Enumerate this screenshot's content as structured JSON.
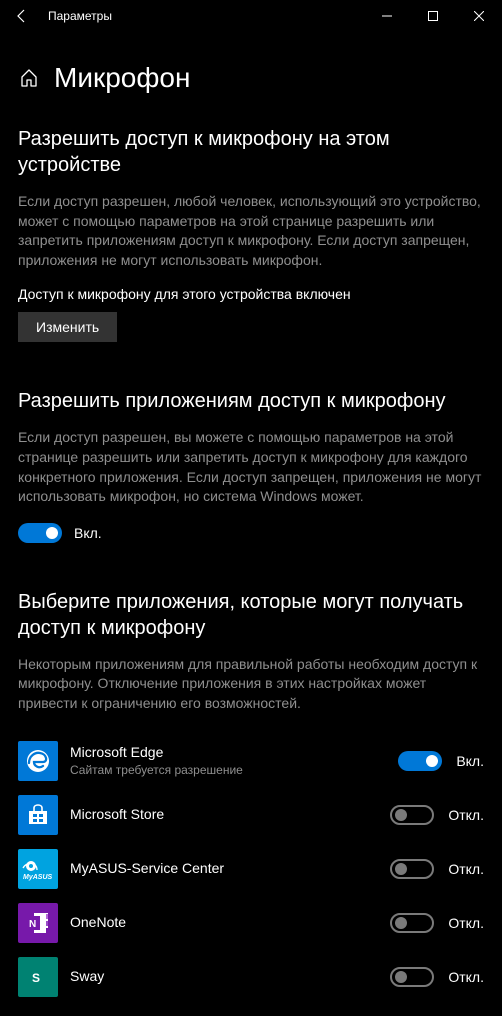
{
  "window": {
    "title": "Параметры"
  },
  "page": {
    "title": "Микрофон"
  },
  "section1": {
    "heading": "Разрешить доступ к микрофону на этом устройстве",
    "desc": "Если доступ разрешен, любой человек, использующий это устройство, может с помощью параметров на этой странице разрешить или запретить приложениям доступ к микрофону. Если доступ запрещен, приложения не могут использовать микрофон.",
    "status": "Доступ к микрофону для этого устройства включен",
    "button": "Изменить"
  },
  "section2": {
    "heading": "Разрешить приложениям доступ к микрофону",
    "desc": "Если доступ разрешен, вы можете с помощью параметров на этой странице разрешить или запретить доступ к микрофону для каждого конкретного приложения. Если доступ запрещен, приложения не могут использовать микрофон, но система Windows может.",
    "toggle_on": true,
    "toggle_label": "Вкл."
  },
  "section3": {
    "heading": "Выберите приложения, которые могут получать доступ к микрофону",
    "desc": "Некоторым приложениям для правильной работы необходим доступ к микрофону. Отключение приложения в этих настройках может привести к ограничению его возможностей."
  },
  "labels": {
    "on": "Вкл.",
    "off": "Откл."
  },
  "apps": [
    {
      "name": "Microsoft Edge",
      "sub": "Сайтам требуется разрешение",
      "on": true,
      "icon_bg": "#0078d7",
      "icon_kind": "edge"
    },
    {
      "name": "Microsoft Store",
      "sub": "",
      "on": false,
      "icon_bg": "#0078d7",
      "icon_kind": "store"
    },
    {
      "name": "MyASUS-Service Center",
      "sub": "",
      "on": false,
      "icon_bg": "#00a3e0",
      "icon_kind": "asus"
    },
    {
      "name": "OneNote",
      "sub": "",
      "on": false,
      "icon_bg": "#7719aa",
      "icon_kind": "onenote"
    },
    {
      "name": "Sway",
      "sub": "",
      "on": false,
      "icon_bg": "#008272",
      "icon_kind": "sway"
    }
  ]
}
